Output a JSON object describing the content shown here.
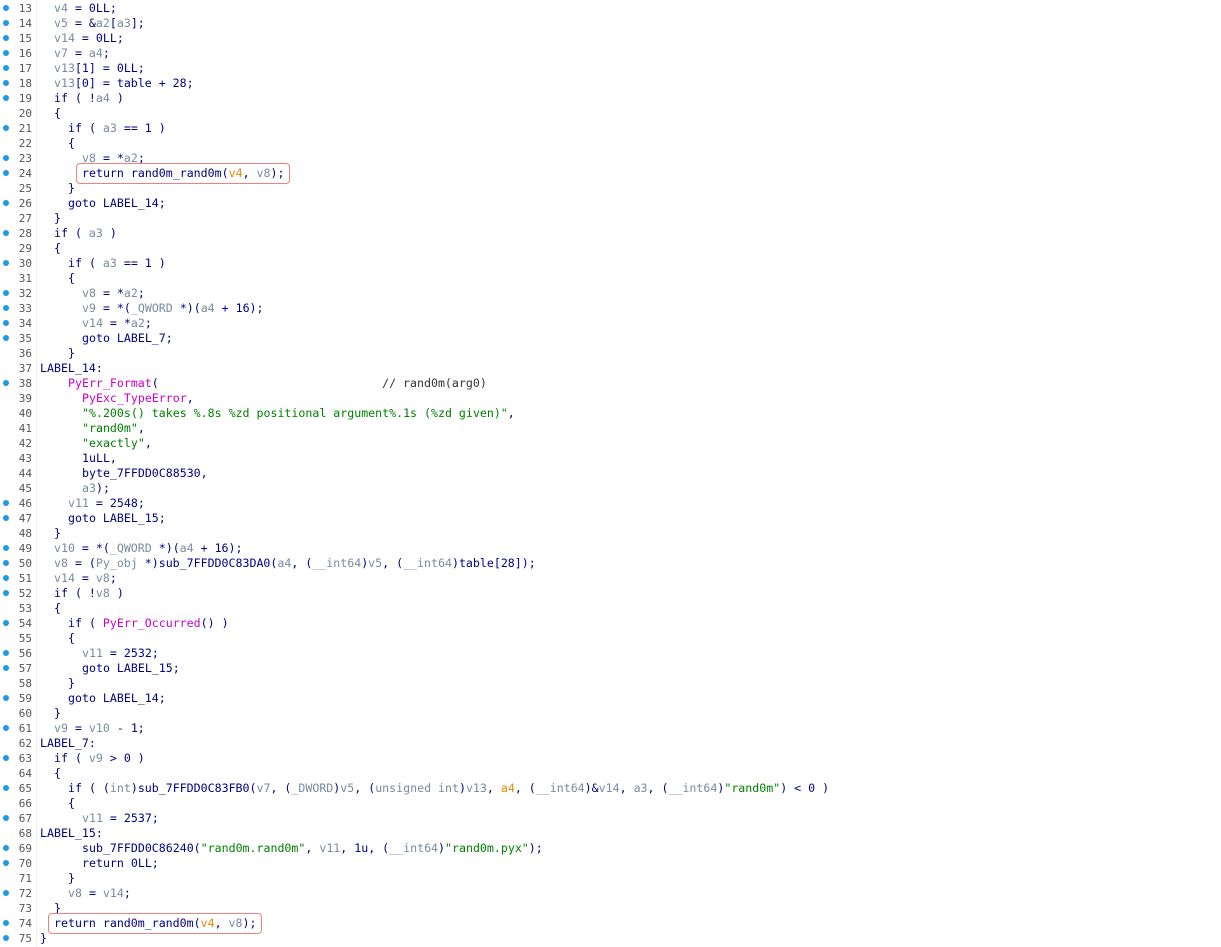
{
  "lines": [
    {
      "n": "13",
      "dot": true,
      "indent": 1,
      "tokens": [
        [
          "var",
          "v4"
        ],
        [
          "id",
          " = 0LL;"
        ]
      ]
    },
    {
      "n": "14",
      "dot": true,
      "indent": 1,
      "tokens": [
        [
          "var",
          "v5"
        ],
        [
          "id",
          " = &"
        ],
        [
          "var",
          "a2"
        ],
        [
          "id",
          "["
        ],
        [
          "var",
          "a3"
        ],
        [
          "id",
          "];"
        ]
      ]
    },
    {
      "n": "15",
      "dot": true,
      "indent": 1,
      "tokens": [
        [
          "var",
          "v14"
        ],
        [
          "id",
          " = 0LL;"
        ]
      ]
    },
    {
      "n": "16",
      "dot": true,
      "indent": 1,
      "tokens": [
        [
          "var",
          "v7"
        ],
        [
          "id",
          " = "
        ],
        [
          "var",
          "a4"
        ],
        [
          "id",
          ";"
        ]
      ]
    },
    {
      "n": "17",
      "dot": true,
      "indent": 1,
      "tokens": [
        [
          "var",
          "v13"
        ],
        [
          "id",
          "[1] = 0LL;"
        ]
      ]
    },
    {
      "n": "18",
      "dot": true,
      "indent": 1,
      "tokens": [
        [
          "var",
          "v13"
        ],
        [
          "id",
          "[0] = table + 28;"
        ]
      ]
    },
    {
      "n": "19",
      "dot": true,
      "indent": 1,
      "tokens": [
        [
          "id",
          "if ( !"
        ],
        [
          "var",
          "a4"
        ],
        [
          "id",
          " )"
        ]
      ]
    },
    {
      "n": "20",
      "dot": false,
      "indent": 1,
      "tokens": [
        [
          "id",
          "{"
        ]
      ]
    },
    {
      "n": "21",
      "dot": true,
      "indent": 2,
      "tokens": [
        [
          "id",
          "if ( "
        ],
        [
          "var",
          "a3"
        ],
        [
          "id",
          " == 1 )"
        ]
      ]
    },
    {
      "n": "22",
      "dot": false,
      "indent": 2,
      "tokens": [
        [
          "id",
          "{"
        ]
      ]
    },
    {
      "n": "23",
      "dot": true,
      "indent": 3,
      "tokens": [
        [
          "var",
          "v8"
        ],
        [
          "id",
          " = *"
        ],
        [
          "var",
          "a2"
        ],
        [
          "id",
          ";"
        ]
      ]
    },
    {
      "n": "24",
      "dot": true,
      "indent": 3,
      "tokens": [
        [
          "id",
          "return rand0m_rand0m("
        ],
        [
          "arg",
          "v4"
        ],
        [
          "id",
          ", "
        ],
        [
          "var",
          "v8"
        ],
        [
          "id",
          ");"
        ]
      ]
    },
    {
      "n": "25",
      "dot": false,
      "indent": 2,
      "tokens": [
        [
          "id",
          "}"
        ]
      ]
    },
    {
      "n": "26",
      "dot": true,
      "indent": 2,
      "tokens": [
        [
          "id",
          "goto LABEL_14;"
        ]
      ]
    },
    {
      "n": "27",
      "dot": false,
      "indent": 1,
      "tokens": [
        [
          "id",
          "}"
        ]
      ]
    },
    {
      "n": "28",
      "dot": true,
      "indent": 1,
      "tokens": [
        [
          "id",
          "if ( "
        ],
        [
          "var",
          "a3"
        ],
        [
          "id",
          " )"
        ]
      ]
    },
    {
      "n": "29",
      "dot": false,
      "indent": 1,
      "tokens": [
        [
          "id",
          "{"
        ]
      ]
    },
    {
      "n": "30",
      "dot": true,
      "indent": 2,
      "tokens": [
        [
          "id",
          "if ( "
        ],
        [
          "var",
          "a3"
        ],
        [
          "id",
          " == 1 )"
        ]
      ]
    },
    {
      "n": "31",
      "dot": false,
      "indent": 2,
      "tokens": [
        [
          "id",
          "{"
        ]
      ]
    },
    {
      "n": "32",
      "dot": true,
      "indent": 3,
      "tokens": [
        [
          "var",
          "v8"
        ],
        [
          "id",
          " = *"
        ],
        [
          "var",
          "a2"
        ],
        [
          "id",
          ";"
        ]
      ]
    },
    {
      "n": "33",
      "dot": true,
      "indent": 3,
      "tokens": [
        [
          "var",
          "v9"
        ],
        [
          "id",
          " = *("
        ],
        [
          "var",
          "_QWORD"
        ],
        [
          "id",
          " *)("
        ],
        [
          "var",
          "a4"
        ],
        [
          "id",
          " + 16);"
        ]
      ]
    },
    {
      "n": "34",
      "dot": true,
      "indent": 3,
      "tokens": [
        [
          "var",
          "v14"
        ],
        [
          "id",
          " = *"
        ],
        [
          "var",
          "a2"
        ],
        [
          "id",
          ";"
        ]
      ]
    },
    {
      "n": "35",
      "dot": true,
      "indent": 3,
      "tokens": [
        [
          "id",
          "goto LABEL_7;"
        ]
      ]
    },
    {
      "n": "36",
      "dot": false,
      "indent": 2,
      "tokens": [
        [
          "id",
          "}"
        ]
      ]
    },
    {
      "n": "37",
      "dot": false,
      "indent": 0,
      "tokens": [
        [
          "id",
          "LABEL_14:"
        ]
      ]
    },
    {
      "n": "38",
      "dot": true,
      "indent": 2,
      "tokens": [
        [
          "fn",
          "PyErr_Format"
        ],
        [
          "id",
          "(                                "
        ],
        [
          "cm",
          "// rand0m(arg0)"
        ]
      ]
    },
    {
      "n": "39",
      "dot": false,
      "indent": 3,
      "tokens": [
        [
          "fn",
          "PyExc_TypeError"
        ],
        [
          "id",
          ","
        ]
      ]
    },
    {
      "n": "40",
      "dot": false,
      "indent": 3,
      "tokens": [
        [
          "str",
          "\"%.200s() takes %.8s %zd positional argument%.1s (%zd given)\""
        ],
        [
          "id",
          ","
        ]
      ]
    },
    {
      "n": "41",
      "dot": false,
      "indent": 3,
      "tokens": [
        [
          "str",
          "\"rand0m\""
        ],
        [
          "id",
          ","
        ]
      ]
    },
    {
      "n": "42",
      "dot": false,
      "indent": 3,
      "tokens": [
        [
          "str",
          "\"exactly\""
        ],
        [
          "id",
          ","
        ]
      ]
    },
    {
      "n": "43",
      "dot": false,
      "indent": 3,
      "tokens": [
        [
          "id",
          "1uLL,"
        ]
      ]
    },
    {
      "n": "44",
      "dot": false,
      "indent": 3,
      "tokens": [
        [
          "id",
          "byte_7FFDD0C88530,"
        ]
      ]
    },
    {
      "n": "45",
      "dot": false,
      "indent": 3,
      "tokens": [
        [
          "var",
          "a3"
        ],
        [
          "id",
          ");"
        ]
      ]
    },
    {
      "n": "46",
      "dot": true,
      "indent": 2,
      "tokens": [
        [
          "var",
          "v11"
        ],
        [
          "id",
          " = 2548;"
        ]
      ]
    },
    {
      "n": "47",
      "dot": true,
      "indent": 2,
      "tokens": [
        [
          "id",
          "goto LABEL_15;"
        ]
      ]
    },
    {
      "n": "48",
      "dot": false,
      "indent": 1,
      "tokens": [
        [
          "id",
          "}"
        ]
      ]
    },
    {
      "n": "49",
      "dot": true,
      "indent": 1,
      "tokens": [
        [
          "var",
          "v10"
        ],
        [
          "id",
          " = *("
        ],
        [
          "var",
          "_QWORD"
        ],
        [
          "id",
          " *)("
        ],
        [
          "var",
          "a4"
        ],
        [
          "id",
          " + 16);"
        ]
      ]
    },
    {
      "n": "50",
      "dot": true,
      "indent": 1,
      "tokens": [
        [
          "var",
          "v8"
        ],
        [
          "id",
          " = ("
        ],
        [
          "var",
          "Py_obj"
        ],
        [
          "id",
          " *)sub_7FFDD0C83DA0("
        ],
        [
          "var",
          "a4"
        ],
        [
          "id",
          ", ("
        ],
        [
          "var",
          "__int64"
        ],
        [
          "id",
          ")"
        ],
        [
          "var",
          "v5"
        ],
        [
          "id",
          ", ("
        ],
        [
          "var",
          "__int64"
        ],
        [
          "id",
          ")table[28]);"
        ]
      ]
    },
    {
      "n": "51",
      "dot": true,
      "indent": 1,
      "tokens": [
        [
          "var",
          "v14"
        ],
        [
          "id",
          " = "
        ],
        [
          "var",
          "v8"
        ],
        [
          "id",
          ";"
        ]
      ]
    },
    {
      "n": "52",
      "dot": true,
      "indent": 1,
      "tokens": [
        [
          "id",
          "if ( !"
        ],
        [
          "var",
          "v8"
        ],
        [
          "id",
          " )"
        ]
      ]
    },
    {
      "n": "53",
      "dot": false,
      "indent": 1,
      "tokens": [
        [
          "id",
          "{"
        ]
      ]
    },
    {
      "n": "54",
      "dot": true,
      "indent": 2,
      "tokens": [
        [
          "id",
          "if ( "
        ],
        [
          "fn",
          "PyErr_Occurred"
        ],
        [
          "id",
          "() )"
        ]
      ]
    },
    {
      "n": "55",
      "dot": false,
      "indent": 2,
      "tokens": [
        [
          "id",
          "{"
        ]
      ]
    },
    {
      "n": "56",
      "dot": true,
      "indent": 3,
      "tokens": [
        [
          "var",
          "v11"
        ],
        [
          "id",
          " = 2532;"
        ]
      ]
    },
    {
      "n": "57",
      "dot": true,
      "indent": 3,
      "tokens": [
        [
          "id",
          "goto LABEL_15;"
        ]
      ]
    },
    {
      "n": "58",
      "dot": false,
      "indent": 2,
      "tokens": [
        [
          "id",
          "}"
        ]
      ]
    },
    {
      "n": "59",
      "dot": true,
      "indent": 2,
      "tokens": [
        [
          "id",
          "goto LABEL_14;"
        ]
      ]
    },
    {
      "n": "60",
      "dot": false,
      "indent": 1,
      "tokens": [
        [
          "id",
          "}"
        ]
      ]
    },
    {
      "n": "61",
      "dot": true,
      "indent": 1,
      "tokens": [
        [
          "var",
          "v9"
        ],
        [
          "id",
          " = "
        ],
        [
          "var",
          "v10"
        ],
        [
          "id",
          " - 1;"
        ]
      ]
    },
    {
      "n": "62",
      "dot": false,
      "indent": 0,
      "tokens": [
        [
          "id",
          "LABEL_7:"
        ]
      ]
    },
    {
      "n": "63",
      "dot": true,
      "indent": 1,
      "tokens": [
        [
          "id",
          "if ( "
        ],
        [
          "var",
          "v9"
        ],
        [
          "id",
          " > 0 )"
        ]
      ]
    },
    {
      "n": "64",
      "dot": false,
      "indent": 1,
      "tokens": [
        [
          "id",
          "{"
        ]
      ]
    },
    {
      "n": "65",
      "dot": true,
      "indent": 2,
      "tokens": [
        [
          "id",
          "if ( ("
        ],
        [
          "var",
          "int"
        ],
        [
          "id",
          ")sub_7FFDD0C83FB0("
        ],
        [
          "var",
          "v7"
        ],
        [
          "id",
          ", ("
        ],
        [
          "var",
          "_DWORD"
        ],
        [
          "id",
          ")"
        ],
        [
          "var",
          "v5"
        ],
        [
          "id",
          ", ("
        ],
        [
          "var",
          "unsigned int"
        ],
        [
          "id",
          ")"
        ],
        [
          "var",
          "v13"
        ],
        [
          "id",
          ", "
        ],
        [
          "arg",
          "a4"
        ],
        [
          "id",
          ", ("
        ],
        [
          "var",
          "__int64"
        ],
        [
          "id",
          ")&"
        ],
        [
          "var",
          "v14"
        ],
        [
          "id",
          ", "
        ],
        [
          "var",
          "a3"
        ],
        [
          "id",
          ", ("
        ],
        [
          "var",
          "__int64"
        ],
        [
          "id",
          ")"
        ],
        [
          "str",
          "\"rand0m\""
        ],
        [
          "id",
          ") < 0 )"
        ]
      ]
    },
    {
      "n": "66",
      "dot": false,
      "indent": 2,
      "tokens": [
        [
          "id",
          "{"
        ]
      ]
    },
    {
      "n": "67",
      "dot": true,
      "indent": 3,
      "tokens": [
        [
          "var",
          "v11"
        ],
        [
          "id",
          " = 2537;"
        ]
      ]
    },
    {
      "n": "68",
      "dot": false,
      "indent": 0,
      "tokens": [
        [
          "id",
          "LABEL_15:"
        ]
      ]
    },
    {
      "n": "69",
      "dot": true,
      "indent": 3,
      "tokens": [
        [
          "id",
          "sub_7FFDD0C86240("
        ],
        [
          "str",
          "\"rand0m.rand0m\""
        ],
        [
          "id",
          ", "
        ],
        [
          "var",
          "v11"
        ],
        [
          "id",
          ", 1u, ("
        ],
        [
          "var",
          "__int64"
        ],
        [
          "id",
          ")"
        ],
        [
          "str",
          "\"rand0m.pyx\""
        ],
        [
          "id",
          ");"
        ]
      ]
    },
    {
      "n": "70",
      "dot": true,
      "indent": 3,
      "tokens": [
        [
          "id",
          "return 0LL;"
        ]
      ]
    },
    {
      "n": "71",
      "dot": false,
      "indent": 2,
      "tokens": [
        [
          "id",
          "}"
        ]
      ]
    },
    {
      "n": "72",
      "dot": true,
      "indent": 2,
      "tokens": [
        [
          "var",
          "v8"
        ],
        [
          "id",
          " = "
        ],
        [
          "var",
          "v14"
        ],
        [
          "id",
          ";"
        ]
      ]
    },
    {
      "n": "73",
      "dot": false,
      "indent": 1,
      "tokens": [
        [
          "id",
          "}"
        ]
      ]
    },
    {
      "n": "74",
      "dot": true,
      "indent": 1,
      "tokens": [
        [
          "id",
          "return rand0m_rand0m("
        ],
        [
          "arg",
          "v4"
        ],
        [
          "id",
          ", "
        ],
        [
          "var",
          "v8"
        ],
        [
          "id",
          ");"
        ]
      ]
    },
    {
      "n": "75",
      "dot": true,
      "indent": 0,
      "tokens": [
        [
          "id",
          "}"
        ]
      ]
    }
  ],
  "highlights": [
    {
      "line": "24",
      "indent": 3
    },
    {
      "line": "74",
      "indent": 1
    }
  ],
  "colors": {
    "background": "#ffffff",
    "identifier": "#000080",
    "variable": "#7a8aa0",
    "argument": "#e58a00",
    "string": "#008000",
    "function": "#cc00cc",
    "breakpoint_dot": "#1e9ae0",
    "highlight_border": "#f08080"
  }
}
